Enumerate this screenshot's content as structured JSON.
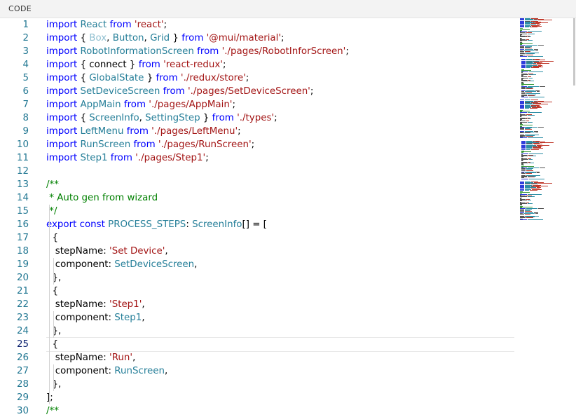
{
  "header": {
    "title": "CODE"
  },
  "editor": {
    "current_line": 25,
    "lines": [
      {
        "n": "1",
        "t": [
          [
            "kw",
            "import "
          ],
          [
            "id",
            "React "
          ],
          [
            "kw",
            "from "
          ],
          [
            "str",
            "'react'"
          ],
          [
            "pl",
            ";"
          ]
        ]
      },
      {
        "n": "2",
        "t": [
          [
            "kw",
            "import "
          ],
          [
            "pl",
            "{ "
          ],
          [
            "dim",
            "Box"
          ],
          [
            "pl",
            ", "
          ],
          [
            "id",
            "Button"
          ],
          [
            "pl",
            ", "
          ],
          [
            "id",
            "Grid "
          ],
          [
            "pl",
            "} "
          ],
          [
            "kw",
            "from "
          ],
          [
            "str",
            "'@mui/material'"
          ],
          [
            "pl",
            ";"
          ]
        ]
      },
      {
        "n": "3",
        "t": [
          [
            "kw",
            "import "
          ],
          [
            "id",
            "RobotInformationScreen "
          ],
          [
            "kw",
            "from "
          ],
          [
            "str",
            "'./pages/RobotInforScreen'"
          ],
          [
            "pl",
            ";"
          ]
        ]
      },
      {
        "n": "4",
        "t": [
          [
            "kw",
            "import "
          ],
          [
            "pl",
            "{ connect } "
          ],
          [
            "kw",
            "from "
          ],
          [
            "str",
            "'react-redux'"
          ],
          [
            "pl",
            ";"
          ]
        ]
      },
      {
        "n": "5",
        "t": [
          [
            "kw",
            "import "
          ],
          [
            "pl",
            "{ "
          ],
          [
            "id",
            "GlobalState "
          ],
          [
            "pl",
            "} "
          ],
          [
            "kw",
            "from "
          ],
          [
            "str",
            "'./redux/store'"
          ],
          [
            "pl",
            ";"
          ]
        ]
      },
      {
        "n": "6",
        "t": [
          [
            "kw",
            "import "
          ],
          [
            "id",
            "SetDeviceScreen "
          ],
          [
            "kw",
            "from "
          ],
          [
            "str",
            "'./pages/SetDeviceScreen'"
          ],
          [
            "pl",
            ";"
          ]
        ]
      },
      {
        "n": "7",
        "t": [
          [
            "kw",
            "import "
          ],
          [
            "id",
            "AppMain "
          ],
          [
            "kw",
            "from "
          ],
          [
            "str",
            "'./pages/AppMain'"
          ],
          [
            "pl",
            ";"
          ]
        ]
      },
      {
        "n": "8",
        "t": [
          [
            "kw",
            "import "
          ],
          [
            "pl",
            "{ "
          ],
          [
            "id",
            "ScreenInfo"
          ],
          [
            "pl",
            ", "
          ],
          [
            "id",
            "SettingStep "
          ],
          [
            "pl",
            "} "
          ],
          [
            "kw",
            "from "
          ],
          [
            "str",
            "'./types'"
          ],
          [
            "pl",
            ";"
          ]
        ]
      },
      {
        "n": "9",
        "t": [
          [
            "kw",
            "import "
          ],
          [
            "id",
            "LeftMenu "
          ],
          [
            "kw",
            "from "
          ],
          [
            "str",
            "'./pages/LeftMenu'"
          ],
          [
            "pl",
            ";"
          ]
        ]
      },
      {
        "n": "10",
        "t": [
          [
            "kw",
            "import "
          ],
          [
            "id",
            "RunScreen "
          ],
          [
            "kw",
            "from "
          ],
          [
            "str",
            "'./pages/RunScreen'"
          ],
          [
            "pl",
            ";"
          ]
        ]
      },
      {
        "n": "11",
        "t": [
          [
            "kw",
            "import "
          ],
          [
            "id",
            "Step1 "
          ],
          [
            "kw",
            "from "
          ],
          [
            "str",
            "'./pages/Step1'"
          ],
          [
            "pl",
            ";"
          ]
        ]
      },
      {
        "n": "12",
        "t": []
      },
      {
        "n": "13",
        "t": [
          [
            "cm",
            "/**"
          ]
        ]
      },
      {
        "n": "14",
        "t": [
          [
            "cm",
            " * Auto gen from wizard"
          ]
        ]
      },
      {
        "n": "15",
        "t": [
          [
            "cm",
            " */"
          ]
        ]
      },
      {
        "n": "16",
        "t": [
          [
            "kw",
            "export const "
          ],
          [
            "id",
            "PROCESS_STEPS"
          ],
          [
            "pl",
            ": "
          ],
          [
            "id",
            "ScreenInfo"
          ],
          [
            "pl",
            "[] = ["
          ]
        ]
      },
      {
        "n": "17",
        "t": [
          [
            "pl",
            "  {"
          ]
        ]
      },
      {
        "n": "18",
        "t": [
          [
            "pl",
            "   stepName: "
          ],
          [
            "str",
            "'Set Device'"
          ],
          [
            "pl",
            ","
          ]
        ]
      },
      {
        "n": "19",
        "t": [
          [
            "pl",
            "   component: "
          ],
          [
            "id",
            "SetDeviceScreen"
          ],
          [
            "pl",
            ","
          ]
        ]
      },
      {
        "n": "20",
        "t": [
          [
            "pl",
            "  },"
          ]
        ]
      },
      {
        "n": "21",
        "t": [
          [
            "pl",
            "  {"
          ]
        ]
      },
      {
        "n": "22",
        "t": [
          [
            "pl",
            "   stepName: "
          ],
          [
            "str",
            "'Step1'"
          ],
          [
            "pl",
            ","
          ]
        ]
      },
      {
        "n": "23",
        "t": [
          [
            "pl",
            "   component: "
          ],
          [
            "id",
            "Step1"
          ],
          [
            "pl",
            ","
          ]
        ]
      },
      {
        "n": "24",
        "t": [
          [
            "pl",
            "  },"
          ]
        ]
      },
      {
        "n": "25",
        "t": [
          [
            "pl",
            "  {"
          ]
        ]
      },
      {
        "n": "26",
        "t": [
          [
            "pl",
            "   stepName: "
          ],
          [
            "str",
            "'Run'"
          ],
          [
            "pl",
            ","
          ]
        ]
      },
      {
        "n": "27",
        "t": [
          [
            "pl",
            "   component: "
          ],
          [
            "id",
            "RunScreen"
          ],
          [
            "pl",
            ","
          ]
        ]
      },
      {
        "n": "28",
        "t": [
          [
            "pl",
            "  },"
          ]
        ]
      },
      {
        "n": "29",
        "t": [
          [
            "pl",
            "];"
          ]
        ]
      },
      {
        "n": "30",
        "t": [
          [
            "cm",
            "/**"
          ]
        ]
      }
    ]
  },
  "minimap": {
    "colors": {
      "keyword": "#2f3cdb",
      "string": "#c0392b",
      "type": "#2e8fa6",
      "comment": "#3a9a3a",
      "plain": "#555555"
    }
  }
}
